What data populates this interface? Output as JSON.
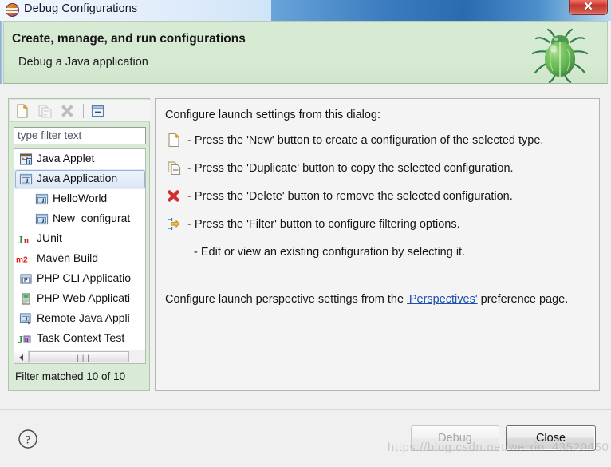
{
  "window": {
    "title": "Debug Configurations",
    "app_icon": "eclipse-icon",
    "close_label": "✕"
  },
  "header": {
    "title": "Create, manage, and run configurations",
    "subtitle": "Debug a Java application",
    "decoration_icon": "green-bug-icon"
  },
  "toolbar": {
    "buttons": [
      {
        "name": "new-configuration",
        "icon": "new-document-icon",
        "enabled": true
      },
      {
        "name": "duplicate-configuration",
        "icon": "duplicate-icon",
        "enabled": false
      },
      {
        "name": "delete-configuration",
        "icon": "delete-x-icon",
        "enabled": false
      },
      {
        "name": "collapse-all",
        "icon": "collapse-all-icon",
        "enabled": true
      }
    ]
  },
  "filter": {
    "placeholder": "type filter text",
    "value": "",
    "status": "Filter matched 10 of 10"
  },
  "tree": {
    "items": [
      {
        "label": "Java Applet",
        "icon": "java-applet-icon",
        "indent": 0,
        "selected": false
      },
      {
        "label": "Java Application",
        "icon": "java-application-icon",
        "indent": 0,
        "selected": true
      },
      {
        "label": "HelloWorld",
        "icon": "java-launch-icon",
        "indent": 1,
        "selected": false
      },
      {
        "label": "New_configurat",
        "icon": "java-launch-icon",
        "indent": 1,
        "selected": false
      },
      {
        "label": "JUnit",
        "icon": "junit-icon",
        "indent": 0,
        "selected": false
      },
      {
        "label": "Maven Build",
        "icon": "maven-m2-icon",
        "indent": 0,
        "selected": false
      },
      {
        "label": "PHP CLI Applicatio",
        "icon": "php-cli-icon",
        "indent": 0,
        "selected": false
      },
      {
        "label": "PHP Web Applicati",
        "icon": "php-web-icon",
        "indent": 0,
        "selected": false
      },
      {
        "label": "Remote Java Appli",
        "icon": "remote-java-icon",
        "indent": 0,
        "selected": false
      },
      {
        "label": "Task Context Test",
        "icon": "task-context-icon",
        "indent": 0,
        "selected": false
      }
    ]
  },
  "content": {
    "intro": "Configure launch settings from this dialog:",
    "bullets": [
      {
        "icon": "new-document-icon",
        "text": "- Press the 'New' button to create a configuration of the selected type."
      },
      {
        "icon": "duplicate-icon",
        "text": "- Press the 'Duplicate' button to copy the selected configuration."
      },
      {
        "icon": "delete-x-icon",
        "text": "- Press the 'Delete' button to remove the selected configuration."
      },
      {
        "icon": "filter-icon",
        "text": "- Press the 'Filter' button to configure filtering options."
      },
      {
        "icon": "none",
        "text": "- Edit or view an existing configuration by selecting it."
      }
    ],
    "footer_prefix": "Configure launch perspective settings from the ",
    "footer_link": "'Perspectives'",
    "footer_suffix": " preference page."
  },
  "footer": {
    "help_icon": "help-question-icon",
    "debug_label": "Debug",
    "debug_enabled": false,
    "close_label": "Close",
    "close_enabled": true
  },
  "watermark": {
    "text": "https://blog.csdn.net/weixin_43520450"
  },
  "colors": {
    "header_green": "#d6e9d2",
    "titlebar_blue": "#3b7cc0",
    "close_red": "#c3362c",
    "link_blue": "#1b50b0",
    "selection_blue": "#dce7f6"
  }
}
